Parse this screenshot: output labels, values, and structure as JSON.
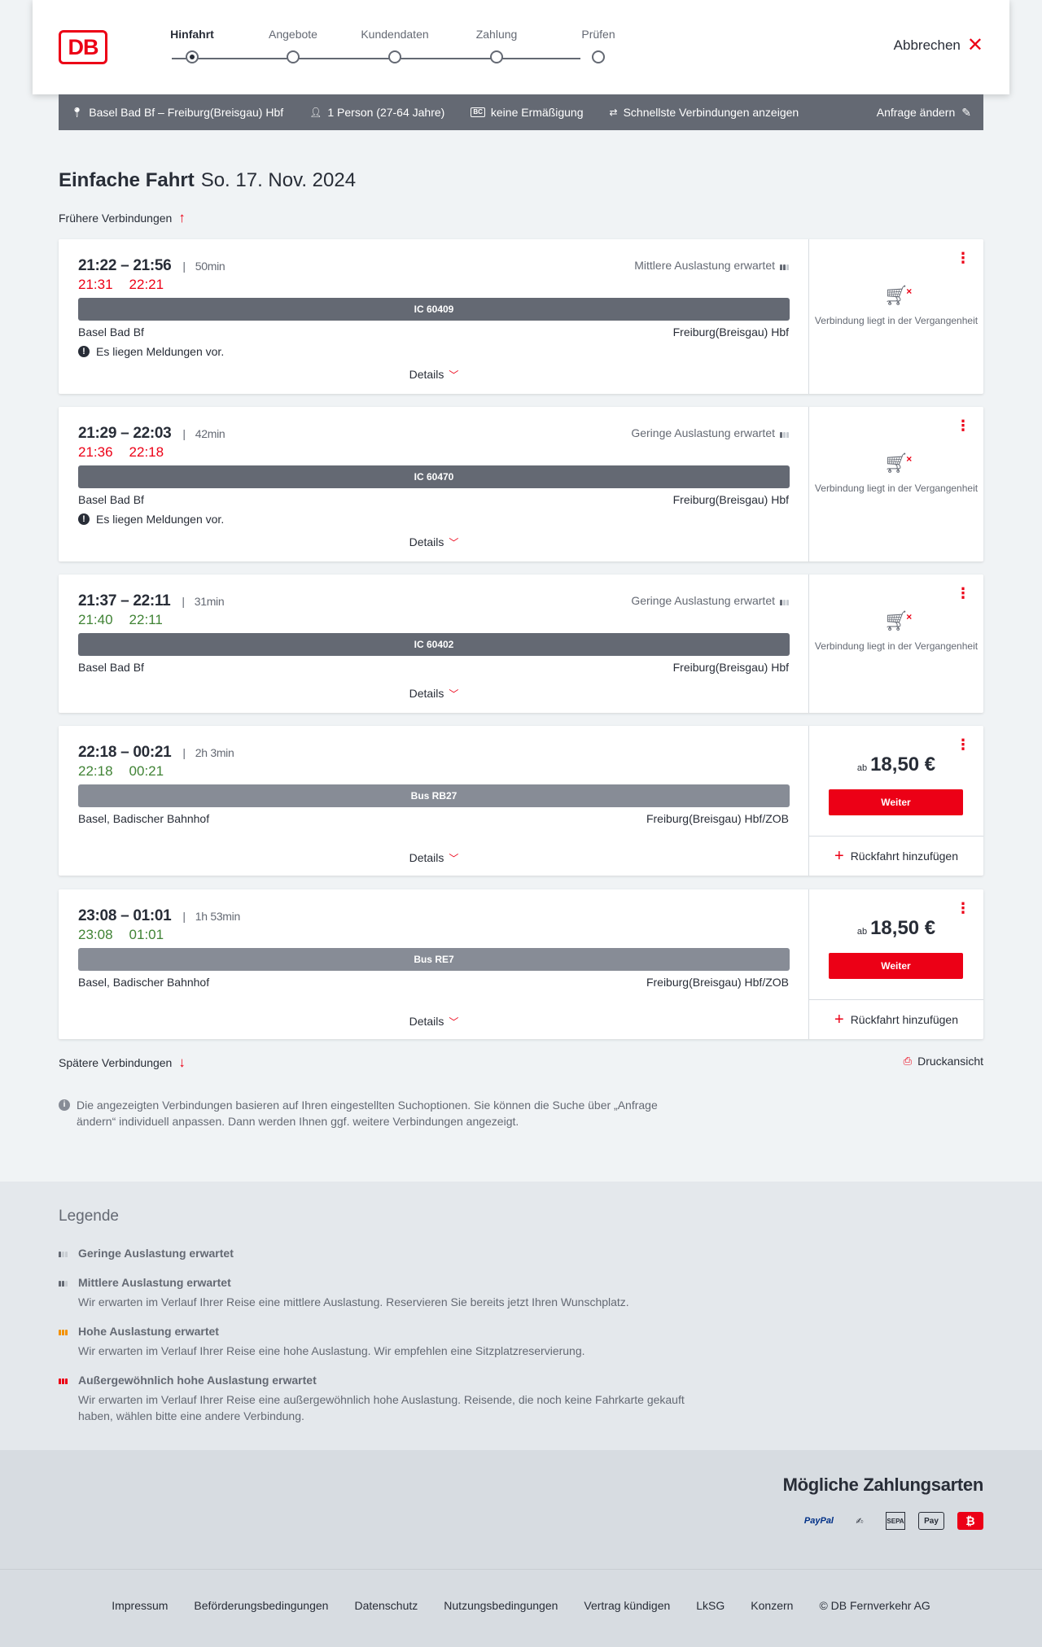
{
  "header": {
    "logo": "DB",
    "steps": [
      {
        "label": "Hinfahrt",
        "active": true
      },
      {
        "label": "Angebote",
        "active": false
      },
      {
        "label": "Kundendaten",
        "active": false
      },
      {
        "label": "Zahlung",
        "active": false
      },
      {
        "label": "Prüfen",
        "active": false
      }
    ],
    "cancel_label": "Abbrechen"
  },
  "search": {
    "route": "Basel Bad Bf – Freiburg(Breisgau) Hbf",
    "travellers": "1 Person (27-64 Jahre)",
    "discount_badge": "BC",
    "discount": "keine Ermäßigung",
    "option": "Schnellste Verbindungen anzeigen",
    "edit_label": "Anfrage ändern"
  },
  "heading": {
    "title": "Einfache Fahrt",
    "date": "So. 17. Nov. 2024"
  },
  "earlier_label": "Frühere Verbindungen",
  "later_label": "Spätere Verbindungen",
  "print_label": "Druckansicht",
  "connections": [
    {
      "times": "21:22 – 21:56",
      "duration": "50min",
      "rt_dep": "21:31",
      "rt_arr": "22:21",
      "rt_status": "late",
      "occupancy": "Mittlere Auslastung erwartet",
      "occupancy_level": 2,
      "train": "IC 60409",
      "mode": "train",
      "from": "Basel Bad Bf",
      "to": "Freiburg(Breisgau) Hbf",
      "message": "Es liegen Meldungen vor.",
      "details": "Details",
      "past": "Verbindung liegt in der Vergangenheit"
    },
    {
      "times": "21:29 – 22:03",
      "duration": "42min",
      "rt_dep": "21:36",
      "rt_arr": "22:18",
      "rt_status": "late",
      "occupancy": "Geringe Auslastung erwartet",
      "occupancy_level": 1,
      "train": "IC 60470",
      "mode": "train",
      "from": "Basel Bad Bf",
      "to": "Freiburg(Breisgau) Hbf",
      "message": "Es liegen Meldungen vor.",
      "details": "Details",
      "past": "Verbindung liegt in der Vergangenheit"
    },
    {
      "times": "21:37 – 22:11",
      "duration": "31min",
      "rt_dep": "21:40",
      "rt_arr": "22:11",
      "rt_status": "ok",
      "occupancy": "Geringe Auslastung erwartet",
      "occupancy_level": 1,
      "train": "IC 60402",
      "mode": "train",
      "from": "Basel Bad Bf",
      "to": "Freiburg(Breisgau) Hbf",
      "details": "Details",
      "past": "Verbindung liegt in der Vergangenheit"
    },
    {
      "times": "22:18 – 00:21",
      "duration": "2h 3min",
      "rt_dep": "22:18",
      "rt_arr": "00:21",
      "rt_status": "ok",
      "train": "Bus RB27",
      "mode": "bus",
      "from": "Basel, Badischer Bahnhof",
      "to": "Freiburg(Breisgau) Hbf/ZOB",
      "details": "Details",
      "price_prefix": "ab",
      "price": "18,50 €",
      "cta": "Weiter",
      "return_label": "Rückfahrt hinzufügen"
    },
    {
      "times": "23:08 – 01:01",
      "duration": "1h 53min",
      "rt_dep": "23:08",
      "rt_arr": "01:01",
      "rt_status": "ok",
      "train": "Bus RE7",
      "mode": "bus",
      "from": "Basel, Badischer Bahnhof",
      "to": "Freiburg(Breisgau) Hbf/ZOB",
      "details": "Details",
      "price_prefix": "ab",
      "price": "18,50 €",
      "cta": "Weiter",
      "return_label": "Rückfahrt hinzufügen"
    }
  ],
  "info_text": "Die angezeigten Verbindungen basieren auf Ihren eingestellten Suchoptionen. Sie können die Suche über „Anfrage ändern“ individuell anpassen. Dann werden Ihnen ggf. weitere Verbindungen angezeigt.",
  "legend": {
    "title": "Legende",
    "items": [
      {
        "title": "Geringe Auslastung erwartet",
        "desc": "",
        "level": 1,
        "color": "#646973"
      },
      {
        "title": "Mittlere Auslastung erwartet",
        "desc": "Wir erwarten im Verlauf Ihrer Reise eine mittlere Auslastung. Reservieren Sie bereits jetzt Ihren Wunschplatz.",
        "level": 2,
        "color": "#646973"
      },
      {
        "title": "Hohe Auslastung erwartet",
        "desc": "Wir erwarten im Verlauf Ihrer Reise eine hohe Auslastung. Wir empfehlen eine Sitzplatzreservierung.",
        "level": 3,
        "color": "#f39200"
      },
      {
        "title": "Außergewöhnlich hohe Auslastung erwartet",
        "desc": "Wir erwarten im Verlauf Ihrer Reise eine außergewöhnlich hohe Auslastung. Reisende, die noch keine Fahrkarte gekauft haben, wählen bitte eine andere Verbindung.",
        "level": 4,
        "color": "#ec0016"
      }
    ]
  },
  "payment": {
    "title": "Mögliche Zahlungsarten",
    "paypal": "PayPal",
    "sepa": "SEPA",
    "applepay": "Pay"
  },
  "footer": {
    "links": [
      "Impressum",
      "Beförderungsbedingungen",
      "Datenschutz",
      "Nutzungsbedingungen",
      "Vertrag kündigen",
      "LkSG",
      "Konzern",
      "© DB Fernverkehr AG"
    ]
  },
  "colors": {
    "brand": "#ec0016",
    "late": "#ec0016",
    "ontime": "#408335",
    "bar": "#646973"
  }
}
